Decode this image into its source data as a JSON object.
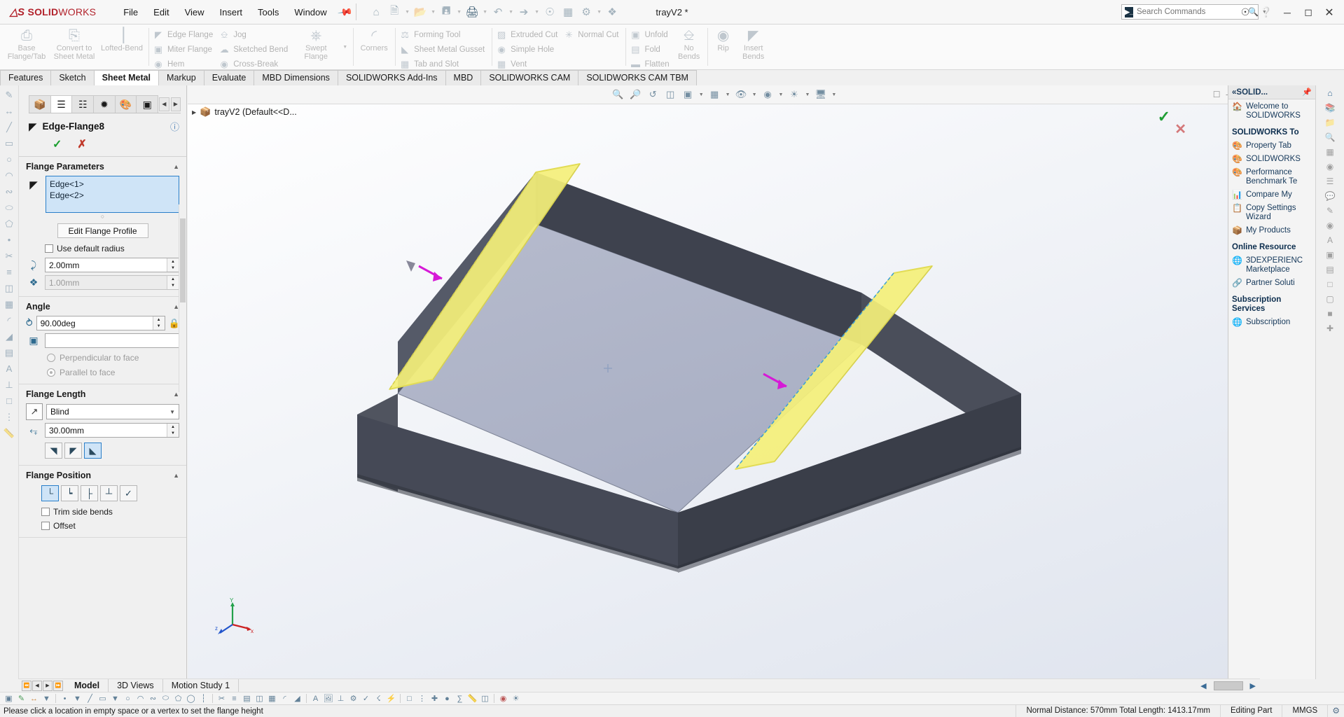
{
  "titlebar": {
    "logo_ds": "DS",
    "logo_main": "SOLID",
    "logo_light": "WORKS",
    "menu": [
      "File",
      "Edit",
      "View",
      "Insert",
      "Tools",
      "Window"
    ],
    "pin_icon": "pushpin-icon",
    "document_title": "trayV2 *",
    "quick_access": [
      "home-icon",
      "new-document-icon",
      "open-document-icon",
      "save-icon",
      "print-icon",
      "undo-icon",
      "select-icon",
      "rebuild-icon",
      "file-properties-icon",
      "options-icon",
      "appearances-icon"
    ],
    "window_controls": [
      "minimize-icon",
      "restore-icon",
      "close-icon"
    ],
    "profile_icon": "user-account-icon",
    "help_icon": "help-icon"
  },
  "search": {
    "placeholder": "Search Commands",
    "value": ""
  },
  "ribbon": {
    "groups": [
      {
        "big": [
          {
            "label": "Base\nFlange/Tab",
            "icon": "base-flange-icon"
          },
          {
            "label": "Convert to\nSheet Metal",
            "icon": "convert-sheet-metal-icon"
          },
          {
            "label": "Lofted-Bend",
            "icon": "lofted-bend-icon"
          }
        ],
        "small": []
      },
      {
        "big": [],
        "small": [
          {
            "label": "Edge Flange",
            "icon": "edge-flange-icon"
          },
          {
            "label": "Miter Flange",
            "icon": "miter-flange-icon"
          },
          {
            "label": "Hem",
            "icon": "hem-icon"
          }
        ]
      },
      {
        "big": [],
        "small": [
          {
            "label": "Jog",
            "icon": "jog-icon"
          },
          {
            "label": "Sketched Bend",
            "icon": "sketched-bend-icon"
          },
          {
            "label": "Cross-Break",
            "icon": "cross-break-icon"
          }
        ]
      },
      {
        "big": [
          {
            "label": "Swept\nFlange",
            "icon": "swept-flange-icon"
          }
        ],
        "small": []
      },
      {
        "big": [
          {
            "label": "Corners",
            "icon": "corners-icon"
          }
        ],
        "small": []
      },
      {
        "big": [],
        "small": [
          {
            "label": "Forming Tool",
            "icon": "forming-tool-icon"
          },
          {
            "label": "Sheet Metal Gusset",
            "icon": "sheet-metal-gusset-icon"
          },
          {
            "label": "Tab and Slot",
            "icon": "tab-and-slot-icon"
          }
        ]
      },
      {
        "big": [],
        "small": [
          {
            "label": "Extruded Cut",
            "icon": "extruded-cut-icon"
          },
          {
            "label": "Simple Hole",
            "icon": "simple-hole-icon"
          },
          {
            "label": "Vent",
            "icon": "vent-icon"
          }
        ]
      },
      {
        "big": [],
        "small": [
          {
            "label": "Normal Cut",
            "icon": "normal-cut-icon"
          }
        ]
      },
      {
        "big": [
          {
            "label": "No\nBends",
            "icon": "no-bends-icon"
          }
        ],
        "small": [
          {
            "label": "Unfold",
            "icon": "unfold-icon"
          },
          {
            "label": "Fold",
            "icon": "fold-icon"
          },
          {
            "label": "Flatten",
            "icon": "flatten-icon"
          }
        ]
      },
      {
        "big": [
          {
            "label": "Rip",
            "icon": "rip-icon"
          },
          {
            "label": "Insert\nBends",
            "icon": "insert-bends-icon"
          }
        ],
        "small": []
      }
    ]
  },
  "tabs": {
    "items": [
      {
        "label": "Features",
        "active": false
      },
      {
        "label": "Sketch",
        "active": false
      },
      {
        "label": "Sheet Metal",
        "active": true
      },
      {
        "label": "Markup",
        "active": false
      },
      {
        "label": "Evaluate",
        "active": false
      },
      {
        "label": "MBD Dimensions",
        "active": false
      },
      {
        "label": "SOLIDWORKS Add-Ins",
        "active": false
      },
      {
        "label": "MBD",
        "active": false
      },
      {
        "label": "SOLIDWORKS CAM",
        "active": false
      },
      {
        "label": "SOLIDWORKS CAM TBM",
        "active": false
      }
    ]
  },
  "property_manager": {
    "tabs": [
      {
        "icon": "feature-tree-icon",
        "active": false
      },
      {
        "icon": "property-manager-icon",
        "active": true
      },
      {
        "icon": "configuration-manager-icon",
        "active": false
      },
      {
        "icon": "dimxpert-manager-icon",
        "active": false
      },
      {
        "icon": "display-manager-icon",
        "active": false
      },
      {
        "icon": "cam-manager-icon",
        "active": false
      }
    ],
    "title": "Edge-Flange8",
    "title_icon": "edge-flange-icon",
    "help_icon": "help-icon",
    "ok_icon": "accept-checkmark-icon",
    "cancel_icon": "cancel-x-icon",
    "flange_parameters": {
      "title": "Flange Parameters",
      "selected_edges": "Edge<1>\nEdge<2>",
      "edge_1": "Edge<1>",
      "edge_2": "Edge<2>",
      "edit_profile_button": "Edit Flange Profile",
      "use_default_radius_label": "Use default radius",
      "use_default_radius_checked": false,
      "radius_value": "2.00mm",
      "gap_value": "1.00mm"
    },
    "angle": {
      "title": "Angle",
      "value": "90.00deg",
      "face_ref_value": "",
      "perpendicular_label": "Perpendicular to face",
      "parallel_label": "Parallel to face",
      "selected_option": "Parallel to face"
    },
    "flange_length": {
      "title": "Flange Length",
      "end_condition": "Blind",
      "length_value": "30.00mm",
      "measure_buttons": [
        "outer-virtual-sharp-icon",
        "inner-virtual-sharp-icon",
        "tangent-bend-icon"
      ],
      "selected_measure_index": 2
    },
    "flange_position": {
      "title": "Flange Position",
      "position_buttons": [
        "material-inside-icon",
        "material-outside-icon",
        "bend-outside-icon",
        "bend-from-virtual-sharp-icon",
        "tangent-to-bend-icon"
      ],
      "selected_position_index": 0,
      "trim_side_bends_label": "Trim side bends",
      "trim_side_bends_checked": false,
      "offset_label": "Offset",
      "offset_checked": false
    }
  },
  "graphics": {
    "tree_root": "trayV2  (Default<<D...",
    "tree_icon": "part-icon",
    "view_toolbar": [
      "zoom-to-fit-icon",
      "zoom-to-area-icon",
      "previous-view-icon",
      "section-view-icon",
      "view-orientation-icon",
      "display-style-icon",
      "hide-show-items-icon",
      "edit-appearance-icon",
      "apply-scene-icon",
      "view-settings-icon"
    ],
    "window_buttons": [
      "restore-window-icon",
      "minimize-window-icon",
      "maximize-window-icon",
      "close-window-icon"
    ],
    "confirm_check": "confirm-accept-icon",
    "confirm_cancel": "confirm-cancel-icon",
    "triad_labels": {
      "x": "x",
      "y": "Y",
      "z": "z"
    },
    "side_tools": [
      "home-view-icon",
      "print3d-icon",
      "appearance-icon",
      "scene-icon",
      "display-pane-icon",
      "magnified-view-icon"
    ]
  },
  "task_pane": {
    "header": "«SOLID...",
    "header_pin": "pin-icon",
    "welcome": "Welcome to\nSOLIDWORKS",
    "sections": [
      {
        "title": "SOLIDWORKS To",
        "items": [
          {
            "label": "Property Tab",
            "icon": "property-tab-builder-icon"
          },
          {
            "label": "SOLIDWORKS",
            "icon": "solidworks-rx-icon"
          },
          {
            "label": "Performance\nBenchmark Te",
            "icon": "benchmark-icon"
          },
          {
            "label": "Compare My",
            "icon": "compare-icon"
          },
          {
            "label": "Copy Settings\nWizard",
            "icon": "copy-settings-icon"
          },
          {
            "label": "My Products",
            "icon": "my-products-icon"
          }
        ]
      },
      {
        "title": "Online Resource",
        "items": [
          {
            "label": "3DEXPERIENC\nMarketplace",
            "icon": "marketplace-icon"
          },
          {
            "label": "Partner Soluti",
            "icon": "partner-icon"
          }
        ]
      },
      {
        "title": "Subscription\nServices",
        "items": [
          {
            "label": "Subscription",
            "icon": "subscription-icon"
          }
        ]
      }
    ],
    "strip_icons": [
      "solidworks-resources-icon",
      "design-library-icon",
      "file-explorer-icon",
      "search-icon",
      "view-palette-icon",
      "appearances-scenes-icon",
      "custom-properties-icon",
      "solidworks-forum-icon"
    ]
  },
  "bottom": {
    "nav_buttons": [
      "first-icon",
      "previous-icon",
      "next-icon",
      "last-icon"
    ],
    "tabs": [
      {
        "label": "Model",
        "active": true
      },
      {
        "label": "3D Views",
        "active": false
      },
      {
        "label": "Motion Study 1",
        "active": false
      }
    ],
    "scroll_left": "scroll-left-icon",
    "scroll_right": "scroll-right-icon"
  },
  "command_bar": {
    "icons": [
      "sketch-icon",
      "smart-dimension-icon",
      "line-icon",
      "rectangle-icon",
      "circle-icon",
      "arc-icon",
      "spline-icon",
      "ellipse-icon",
      "polygon-icon",
      "point-icon",
      "centerline-icon",
      "trim-icon",
      "offset-icon",
      "mirror-icon",
      "pattern-icon",
      "fillet-icon",
      "chamfer-icon",
      "convert-entities-icon",
      "text-icon",
      "relation-icon",
      "repair-sketch-icon",
      "3d-sketch-icon",
      "plane-icon",
      "axis-icon",
      "coordinate-icon",
      "equation-icon",
      "measure-icon"
    ]
  },
  "status_bar": {
    "message": "Please click a location in empty space or a vertex to set the flange height",
    "measurement": "Normal Distance: 570mm Total Length: 1413.17mm",
    "edit_mode": "Editing Part",
    "units": "MMGS",
    "units_icon": "units-settings-icon"
  }
}
